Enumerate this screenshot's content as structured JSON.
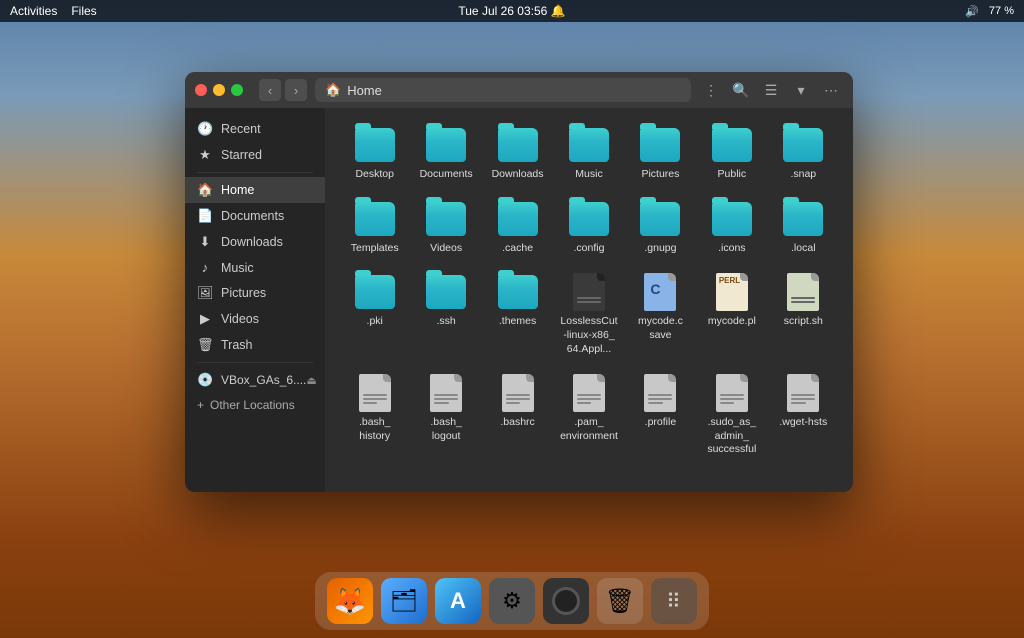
{
  "topbar": {
    "activities": "Activities",
    "app_name": "Files",
    "datetime": "Tue Jul 26  03:56",
    "battery": "77 %"
  },
  "window": {
    "title": "Home",
    "path_icon": "🏠",
    "path_label": "Home"
  },
  "sidebar": {
    "items": [
      {
        "id": "recent",
        "label": "Recent",
        "icon": "🕐",
        "active": false
      },
      {
        "id": "starred",
        "label": "Starred",
        "icon": "★",
        "active": false
      },
      {
        "id": "home",
        "label": "Home",
        "icon": "🏠",
        "active": true
      },
      {
        "id": "documents",
        "label": "Documents",
        "icon": "📄",
        "active": false
      },
      {
        "id": "downloads",
        "label": "Downloads",
        "icon": "⬇",
        "active": false
      },
      {
        "id": "music",
        "label": "Music",
        "icon": "♪",
        "active": false
      },
      {
        "id": "pictures",
        "label": "Pictures",
        "icon": "🖼",
        "active": false
      },
      {
        "id": "videos",
        "label": "Videos",
        "icon": "▶",
        "active": false
      },
      {
        "id": "trash",
        "label": "Trash",
        "icon": "🗑",
        "active": false
      }
    ],
    "device_label": "VBox_GAs_6....",
    "other_locations": "+ Other Locations"
  },
  "files": [
    {
      "name": "Desktop",
      "type": "folder"
    },
    {
      "name": "Documents",
      "type": "folder"
    },
    {
      "name": "Downloads",
      "type": "folder"
    },
    {
      "name": "Music",
      "type": "folder"
    },
    {
      "name": "Pictures",
      "type": "folder"
    },
    {
      "name": "Public",
      "type": "folder"
    },
    {
      "name": ".snap",
      "type": "folder"
    },
    {
      "name": "Templates",
      "type": "folder"
    },
    {
      "name": "Videos",
      "type": "folder"
    },
    {
      "name": ".cache",
      "type": "folder"
    },
    {
      "name": ".config",
      "type": "folder"
    },
    {
      "name": ".gnupg",
      "type": "folder"
    },
    {
      "name": ".icons",
      "type": "folder"
    },
    {
      "name": ".local",
      "type": "folder"
    },
    {
      "name": ".pki",
      "type": "folder"
    },
    {
      "name": ".ssh",
      "type": "folder"
    },
    {
      "name": ".themes",
      "type": "folder"
    },
    {
      "name": "LosslessCut‑linux‑x86_​64.Appl...",
      "type": "dark-doc"
    },
    {
      "name": "mycode.c​save",
      "type": "c-file"
    },
    {
      "name": "mycode.pl",
      "type": "perl-file"
    },
    {
      "name": "script.sh",
      "type": "script"
    },
    {
      "name": ".bash_​history",
      "type": "doc"
    },
    {
      "name": ".bash_​logout",
      "type": "doc"
    },
    {
      "name": ".bashrc",
      "type": "doc"
    },
    {
      "name": ".pam_​environ​ment",
      "type": "doc"
    },
    {
      "name": ".profile",
      "type": "doc"
    },
    {
      "name": ".sudo_as_​admin_​successful",
      "type": "doc"
    },
    {
      "name": ".wget-hsts",
      "type": "doc"
    }
  ],
  "dock": {
    "items": [
      {
        "id": "firefox",
        "label": "Firefox",
        "emoji": "🦊"
      },
      {
        "id": "finder",
        "label": "Files",
        "emoji": "🗂"
      },
      {
        "id": "appstore",
        "label": "App Store",
        "emoji": "A"
      },
      {
        "id": "settings",
        "label": "Settings",
        "emoji": "⚙"
      },
      {
        "id": "camera",
        "label": "Camera",
        "emoji": "⚫"
      },
      {
        "id": "trash",
        "label": "Trash",
        "emoji": "🗑"
      },
      {
        "id": "grid",
        "label": "Grid",
        "emoji": "⠿"
      }
    ]
  }
}
